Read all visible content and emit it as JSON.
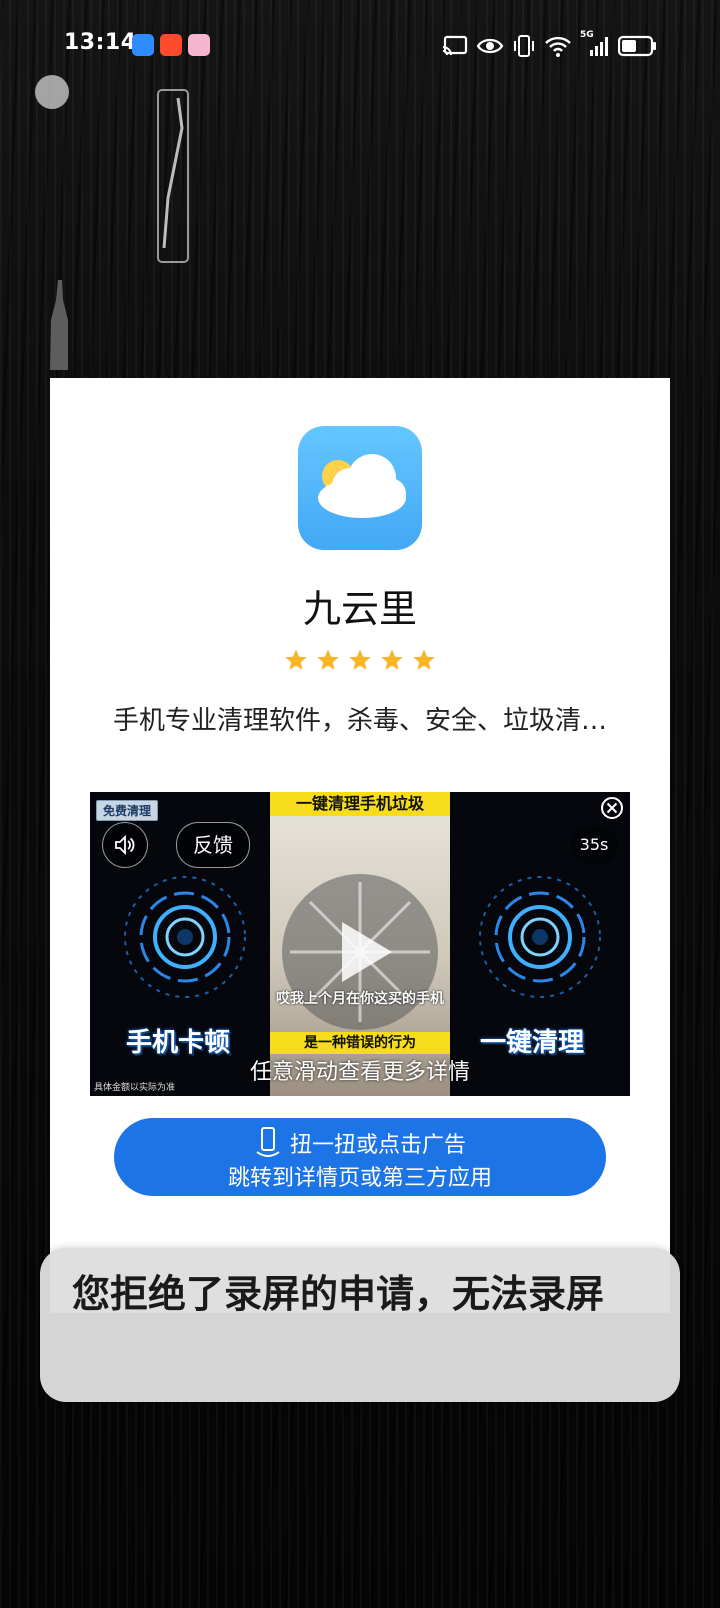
{
  "status_bar": {
    "time": "13:14",
    "network": "5G",
    "notification_icons": [
      "app-blue-icon",
      "app-red-icon",
      "app-pink-icon"
    ],
    "system_icons": [
      "cast-icon",
      "eye-icon",
      "vibrate-icon",
      "wifi-icon",
      "signal-icon",
      "battery-icon"
    ]
  },
  "dialog": {
    "app_name": "九云里",
    "rating_stars": 5,
    "description": "手机专业清理软件，杀毒、安全、垃圾清…",
    "colors": {
      "icon_bg": "#4fb4fb",
      "star": "#f7b529",
      "cta_bg": "#1d74e6"
    }
  },
  "ad": {
    "free_tag": "免费清理",
    "feedback_label": "反馈",
    "countdown": "35s",
    "top_banner": "一键清理手机垃圾",
    "left_label": "手机卡顿",
    "right_label": "一键清理",
    "center_caption": "哎我上个月在你这买的手机",
    "center_strip": "是一种错误的行为",
    "small_note": "具体金额以实际为准",
    "swipe_hint": "任意滑动查看更多详情"
  },
  "cta": {
    "line1": "扭一扭或点击广告",
    "line2": "跳转到详情页或第三方应用"
  },
  "toast": {
    "message": "您拒绝了录屏的申请，无法录屏"
  }
}
